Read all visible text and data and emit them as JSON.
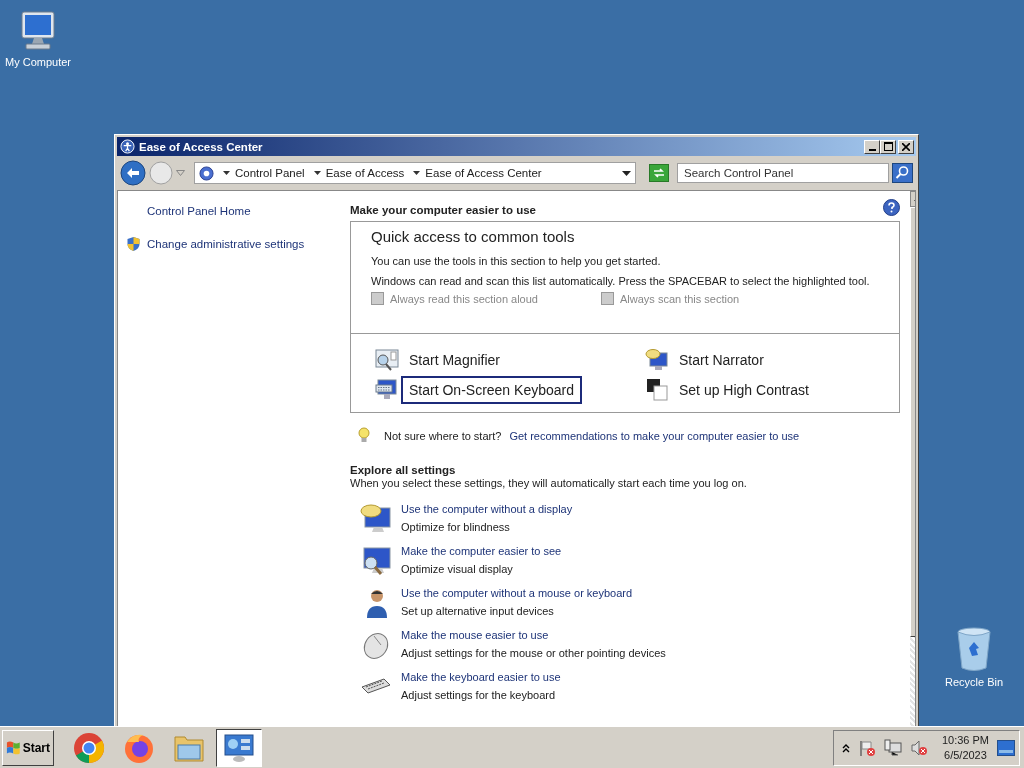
{
  "desktop_icons": [
    {
      "label": "My Computer",
      "kind": "computer"
    },
    {
      "label": "Recycle Bin",
      "kind": "recycle"
    }
  ],
  "window": {
    "title": "Ease of Access Center",
    "breadcrumbs": [
      "Control Panel",
      "Ease of Access",
      "Ease of Access Center"
    ],
    "search": {
      "placeholder": "Search Control Panel"
    }
  },
  "sidebar": {
    "items": [
      {
        "label": "Control Panel Home",
        "kind": "plain"
      },
      {
        "label": "Change administrative settings",
        "kind": "shield"
      }
    ]
  },
  "main": {
    "heading": "Make your computer easier to use",
    "quick_access": {
      "title": "Quick access to common tools",
      "lines": [
        "You can use the tools in this section to help you get started.",
        "Windows can read and scan this list automatically.  Press the SPACEBAR to select the highlighted tool."
      ],
      "options": [
        {
          "label": "Always read this section aloud",
          "checked": false,
          "disabled": true
        },
        {
          "label": "Always scan this section",
          "checked": false,
          "disabled": true
        }
      ],
      "tools": [
        {
          "label": "Start Magnifier",
          "kind": "magnifier",
          "selected": false
        },
        {
          "label": "Start Narrator",
          "kind": "narrator",
          "selected": false
        },
        {
          "label": "Start On-Screen Keyboard",
          "kind": "keyboard",
          "selected": true
        },
        {
          "label": "Set up High Contrast",
          "kind": "contrast",
          "selected": false
        }
      ]
    },
    "tip": {
      "text": "Not sure where to start?",
      "link": "Get recommendations to make your computer easier to use"
    },
    "explore": {
      "heading": "Explore all settings",
      "subtitle": "When you select these settings, they will automatically start each time you log on.",
      "items": [
        {
          "link": "Use the computer without a display",
          "description": "Optimize for blindness",
          "kind": "display"
        },
        {
          "link": "Make the computer easier to see",
          "description": "Optimize visual display",
          "kind": "see"
        },
        {
          "link": "Use the computer without a mouse or keyboard",
          "description": "Set up alternative input devices",
          "kind": "person"
        },
        {
          "link": "Make the mouse easier to use",
          "description": "Adjust settings for the mouse or other pointing devices",
          "kind": "mouse"
        },
        {
          "link": "Make the keyboard easier to use",
          "description": "Adjust settings for the keyboard",
          "kind": "keyboard"
        }
      ]
    }
  },
  "taskbar": {
    "start": "Start",
    "apps": [
      {
        "kind": "chrome",
        "selected": false
      },
      {
        "kind": "firefox",
        "selected": false
      },
      {
        "kind": "explorer",
        "selected": false
      },
      {
        "kind": "control",
        "selected": true
      }
    ],
    "clock": {
      "time": "10:36 PM",
      "date": "6/5/2023"
    }
  }
}
